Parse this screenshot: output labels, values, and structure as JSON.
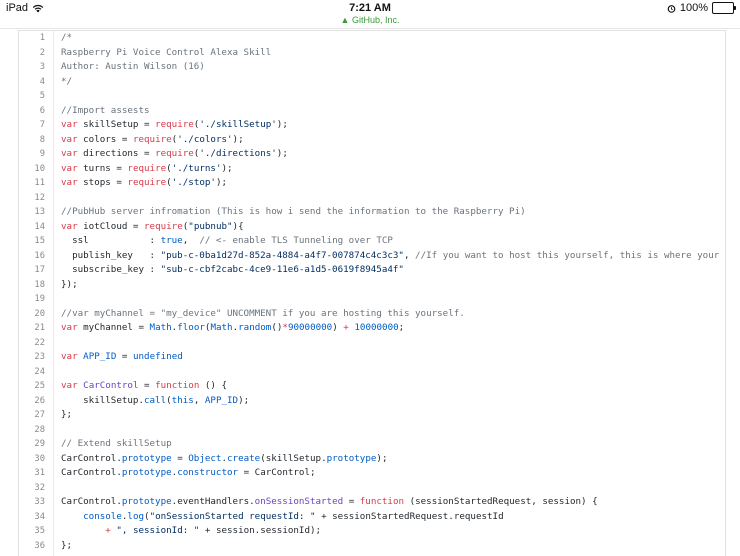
{
  "status_bar": {
    "device": "iPad",
    "time": "7:21 AM",
    "site": "GitHub, Inc.",
    "battery": "100%",
    "battery_level": 1.0
  },
  "code_lines": [
    {
      "n": "1",
      "tokens": [
        {
          "t": "/*",
          "c": "c"
        }
      ]
    },
    {
      "n": "2",
      "tokens": [
        {
          "t": "Raspberry Pi Voice Control Alexa Skill",
          "c": "c"
        }
      ]
    },
    {
      "n": "3",
      "tokens": [
        {
          "t": "Author: Austin Wilson (16)",
          "c": "c"
        }
      ]
    },
    {
      "n": "4",
      "tokens": [
        {
          "t": "*/",
          "c": "c"
        }
      ]
    },
    {
      "n": "5",
      "tokens": []
    },
    {
      "n": "6",
      "tokens": [
        {
          "t": "//Import assests",
          "c": "c"
        }
      ]
    },
    {
      "n": "7",
      "tokens": [
        {
          "t": "var",
          "c": "k"
        },
        {
          "t": " skillSetup = ",
          "c": ""
        },
        {
          "t": "require",
          "c": "k"
        },
        {
          "t": "(",
          "c": ""
        },
        {
          "t": "'./skillSetup'",
          "c": "s"
        },
        {
          "t": ");",
          "c": ""
        }
      ]
    },
    {
      "n": "8",
      "tokens": [
        {
          "t": "var",
          "c": "k"
        },
        {
          "t": " colors = ",
          "c": ""
        },
        {
          "t": "require",
          "c": "k"
        },
        {
          "t": "(",
          "c": ""
        },
        {
          "t": "'./colors'",
          "c": "s"
        },
        {
          "t": ");",
          "c": ""
        }
      ]
    },
    {
      "n": "9",
      "tokens": [
        {
          "t": "var",
          "c": "k"
        },
        {
          "t": " directions = ",
          "c": ""
        },
        {
          "t": "require",
          "c": "k"
        },
        {
          "t": "(",
          "c": ""
        },
        {
          "t": "'./directions'",
          "c": "s"
        },
        {
          "t": ");",
          "c": ""
        }
      ]
    },
    {
      "n": "10",
      "tokens": [
        {
          "t": "var",
          "c": "k"
        },
        {
          "t": " turns = ",
          "c": ""
        },
        {
          "t": "require",
          "c": "k"
        },
        {
          "t": "(",
          "c": ""
        },
        {
          "t": "'./turns'",
          "c": "s"
        },
        {
          "t": ");",
          "c": ""
        }
      ]
    },
    {
      "n": "11",
      "tokens": [
        {
          "t": "var",
          "c": "k"
        },
        {
          "t": " stops = ",
          "c": ""
        },
        {
          "t": "require",
          "c": "k"
        },
        {
          "t": "(",
          "c": ""
        },
        {
          "t": "'./stop'",
          "c": "s"
        },
        {
          "t": ");",
          "c": ""
        }
      ]
    },
    {
      "n": "12",
      "tokens": []
    },
    {
      "n": "13",
      "tokens": [
        {
          "t": "//PubHub server infromation (This is how i send the information to the Raspberry Pi)",
          "c": "c"
        }
      ]
    },
    {
      "n": "14",
      "tokens": [
        {
          "t": "var",
          "c": "k"
        },
        {
          "t": " iotCloud = ",
          "c": ""
        },
        {
          "t": "require",
          "c": "k"
        },
        {
          "t": "(",
          "c": ""
        },
        {
          "t": "\"pubnub\"",
          "c": "s"
        },
        {
          "t": "){",
          "c": ""
        }
      ]
    },
    {
      "n": "15",
      "tokens": [
        {
          "t": "  ssl           : ",
          "c": ""
        },
        {
          "t": "true",
          "c": "n"
        },
        {
          "t": ",  ",
          "c": ""
        },
        {
          "t": "// <- enable TLS Tunneling over TCP",
          "c": "c"
        }
      ]
    },
    {
      "n": "16",
      "tokens": [
        {
          "t": "  publish_key   : ",
          "c": ""
        },
        {
          "t": "\"pub-c-0ba1d27d-852a-4884-a4f7-007874c4c3c3\"",
          "c": "s"
        },
        {
          "t": ", ",
          "c": ""
        },
        {
          "t": "//If you want to host this yourself, this is where your publish",
          "c": "c"
        }
      ]
    },
    {
      "n": "17",
      "tokens": [
        {
          "t": "  subscribe_key : ",
          "c": ""
        },
        {
          "t": "\"sub-c-cbf2cabc-4ce9-11e6-a1d5-0619f8945a4f\"",
          "c": "s"
        }
      ]
    },
    {
      "n": "18",
      "tokens": [
        {
          "t": "});",
          "c": ""
        }
      ]
    },
    {
      "n": "19",
      "tokens": []
    },
    {
      "n": "20",
      "tokens": [
        {
          "t": "//var myChannel = \"my_device\" UNCOMMENT if you are hosting this yourself.",
          "c": "c"
        }
      ]
    },
    {
      "n": "21",
      "tokens": [
        {
          "t": "var",
          "c": "k"
        },
        {
          "t": " myChannel = ",
          "c": ""
        },
        {
          "t": "Math",
          "c": "n"
        },
        {
          "t": ".",
          "c": ""
        },
        {
          "t": "floor",
          "c": "n"
        },
        {
          "t": "(",
          "c": ""
        },
        {
          "t": "Math",
          "c": "n"
        },
        {
          "t": ".",
          "c": ""
        },
        {
          "t": "random",
          "c": "n"
        },
        {
          "t": "()",
          "c": ""
        },
        {
          "t": "*",
          "c": "k"
        },
        {
          "t": "90000000",
          "c": "n"
        },
        {
          "t": ") ",
          "c": ""
        },
        {
          "t": "+",
          "c": "k"
        },
        {
          "t": " ",
          "c": ""
        },
        {
          "t": "10000000",
          "c": "n"
        },
        {
          "t": ";",
          "c": ""
        }
      ]
    },
    {
      "n": "22",
      "tokens": []
    },
    {
      "n": "23",
      "tokens": [
        {
          "t": "var",
          "c": "k"
        },
        {
          "t": " ",
          "c": ""
        },
        {
          "t": "APP_ID",
          "c": "n"
        },
        {
          "t": " = ",
          "c": ""
        },
        {
          "t": "undefined",
          "c": "n"
        }
      ]
    },
    {
      "n": "24",
      "tokens": []
    },
    {
      "n": "25",
      "tokens": [
        {
          "t": "var",
          "c": "k"
        },
        {
          "t": " ",
          "c": ""
        },
        {
          "t": "CarControl",
          "c": "f"
        },
        {
          "t": " = ",
          "c": ""
        },
        {
          "t": "function",
          "c": "k"
        },
        {
          "t": " () {",
          "c": ""
        }
      ]
    },
    {
      "n": "26",
      "tokens": [
        {
          "t": "    skillSetup.",
          "c": ""
        },
        {
          "t": "call",
          "c": "n"
        },
        {
          "t": "(",
          "c": ""
        },
        {
          "t": "this",
          "c": "n"
        },
        {
          "t": ", ",
          "c": ""
        },
        {
          "t": "APP_ID",
          "c": "n"
        },
        {
          "t": ");",
          "c": ""
        }
      ]
    },
    {
      "n": "27",
      "tokens": [
        {
          "t": "};",
          "c": ""
        }
      ]
    },
    {
      "n": "28",
      "tokens": []
    },
    {
      "n": "29",
      "tokens": [
        {
          "t": "// Extend skillSetup",
          "c": "c"
        }
      ]
    },
    {
      "n": "30",
      "tokens": [
        {
          "t": "CarControl.",
          "c": ""
        },
        {
          "t": "prototype",
          "c": "n"
        },
        {
          "t": " = ",
          "c": ""
        },
        {
          "t": "Object",
          "c": "n"
        },
        {
          "t": ".",
          "c": ""
        },
        {
          "t": "create",
          "c": "n"
        },
        {
          "t": "(skillSetup.",
          "c": ""
        },
        {
          "t": "prototype",
          "c": "n"
        },
        {
          "t": ");",
          "c": ""
        }
      ]
    },
    {
      "n": "31",
      "tokens": [
        {
          "t": "CarControl.",
          "c": ""
        },
        {
          "t": "prototype",
          "c": "n"
        },
        {
          "t": ".",
          "c": ""
        },
        {
          "t": "constructor",
          "c": "n"
        },
        {
          "t": " = CarControl;",
          "c": ""
        }
      ]
    },
    {
      "n": "32",
      "tokens": []
    },
    {
      "n": "33",
      "tokens": [
        {
          "t": "CarControl.",
          "c": ""
        },
        {
          "t": "prototype",
          "c": "n"
        },
        {
          "t": ".eventHandlers.",
          "c": ""
        },
        {
          "t": "onSessionStarted",
          "c": "f"
        },
        {
          "t": " = ",
          "c": ""
        },
        {
          "t": "function",
          "c": "k"
        },
        {
          "t": " (sessionStartedRequest, session) {",
          "c": ""
        }
      ]
    },
    {
      "n": "34",
      "tokens": [
        {
          "t": "    ",
          "c": ""
        },
        {
          "t": "console",
          "c": "n"
        },
        {
          "t": ".",
          "c": ""
        },
        {
          "t": "log",
          "c": "n"
        },
        {
          "t": "(",
          "c": ""
        },
        {
          "t": "\"onSessionStarted requestId: \"",
          "c": "s"
        },
        {
          "t": " + sessionStartedRequest.requestId",
          "c": ""
        }
      ]
    },
    {
      "n": "35",
      "tokens": [
        {
          "t": "        ",
          "c": ""
        },
        {
          "t": "+",
          "c": "k"
        },
        {
          "t": " ",
          "c": ""
        },
        {
          "t": "\", sessionId: \"",
          "c": "s"
        },
        {
          "t": " + session.sessionId);",
          "c": ""
        }
      ]
    },
    {
      "n": "36",
      "tokens": [
        {
          "t": "};",
          "c": ""
        }
      ]
    }
  ]
}
